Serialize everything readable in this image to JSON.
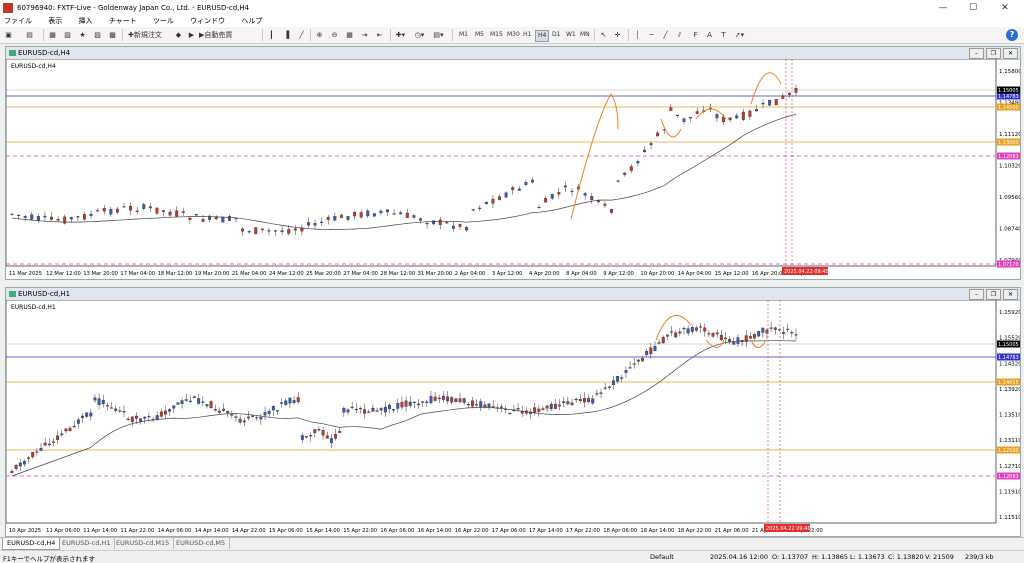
{
  "window": {
    "title": "60796940: FXTF-Live - Goldenway Japan Co., Ltd. - EURUSD-cd,H4"
  },
  "menu": [
    "ファイル",
    "表示",
    "挿入",
    "チャート",
    "ツール",
    "ウィンドウ",
    "ヘルプ"
  ],
  "toolbar": {
    "new_order_label": "新規注文",
    "auto_trade_label": "自動売買",
    "timeframes": [
      "M1",
      "M5",
      "M15",
      "M30",
      "H1",
      "H4",
      "D1",
      "W1",
      "MN"
    ],
    "active_timeframe": "H4"
  },
  "charts": [
    {
      "window_title": "EURUSD-cd,H4",
      "inner_label": "EURUSD-cd,H4",
      "price_labels": [
        "1.15800",
        "1.13480",
        "1.11120",
        "1.10320",
        "1.09560",
        "1.08740",
        "1.07940"
      ],
      "current_price": "1.15005",
      "hlines": [
        {
          "price": "1.14783",
          "color": "#3333cc"
        },
        {
          "price": "1.14500",
          "color": "#e8a020"
        },
        {
          "price": "1.13000",
          "color": "#e8a020"
        },
        {
          "price": "1.12083",
          "color": "#e040c0"
        },
        {
          "price": "1.07170",
          "color": "#e040c0"
        }
      ],
      "time_labels": [
        "11 Mar 2025",
        "12 Mar 12:00",
        "13 Mar 20:00",
        "17 Mar 04:00",
        "18 Mar 12:00",
        "19 Mar 20:00",
        "21 Mar 04:00",
        "24 Mar 12:00",
        "25 Mar 20:00",
        "27 Mar 04:00",
        "28 Mar 12:00",
        "31 Mar 20:00",
        "2 Apr 04:00",
        "3 Apr 12:00",
        "4 Apr 20:00",
        "8 Apr 04:00",
        "9 Apr 12:00",
        "10 Apr 20:00",
        "14 Apr 04:00",
        "15 Apr 12:00",
        "16 Apr 20:00",
        "18 Apr 04:00"
      ],
      "cursor_time": "2025.04.22 09:40"
    },
    {
      "window_title": "EURUSD-cd,H1",
      "inner_label": "EURUSD-cd,H1",
      "price_labels": [
        "1.15920",
        "1.15520",
        "1.14320",
        "1.13920",
        "1.13510",
        "1.13110",
        "1.12710",
        "1.11910",
        "1.11510"
      ],
      "current_price": "1.15005",
      "hlines": [
        {
          "price": "1.14783",
          "color": "#3333cc"
        },
        {
          "price": "1.14015",
          "color": "#e8a020"
        },
        {
          "price": "1.12500",
          "color": "#e8a020"
        },
        {
          "price": "1.12083",
          "color": "#e040c0"
        }
      ],
      "time_labels": [
        "10 Apr 2025",
        "11 Apr 06:00",
        "11 Apr 14:00",
        "11 Apr 22:00",
        "14 Apr 06:00",
        "14 Apr 14:00",
        "14 Apr 22:00",
        "15 Apr 06:00",
        "15 Apr 14:00",
        "15 Apr 22:00",
        "16 Apr 06:00",
        "16 Apr 14:00",
        "16 Apr 22:00",
        "17 Apr 06:00",
        "17 Apr 14:00",
        "17 Apr 22:00",
        "18 Apr 06:00",
        "18 Apr 14:00",
        "18 Apr 22:00",
        "21 Apr 06:00",
        "21 Apr 14:00",
        "21 Apr 22:00"
      ],
      "cursor_time": "2025.04.22 09:40"
    }
  ],
  "tabs": [
    "EURUSD-cd,H4",
    "EURUSD-cd,H1",
    "EURUSD-cd,M15",
    "EURUSD-cd,M5"
  ],
  "active_tab": "EURUSD-cd,H4",
  "status": {
    "help": "F1キーでヘルプが表示されます",
    "profile": "Default",
    "datetime": "2025.04.16 12:00",
    "open": "O: 1.13707",
    "high": "H: 1.13865",
    "low": "L: 1.13673",
    "close": "C: 1.13820",
    "volume": "V: 21509",
    "traffic": "239/3 kb"
  }
}
